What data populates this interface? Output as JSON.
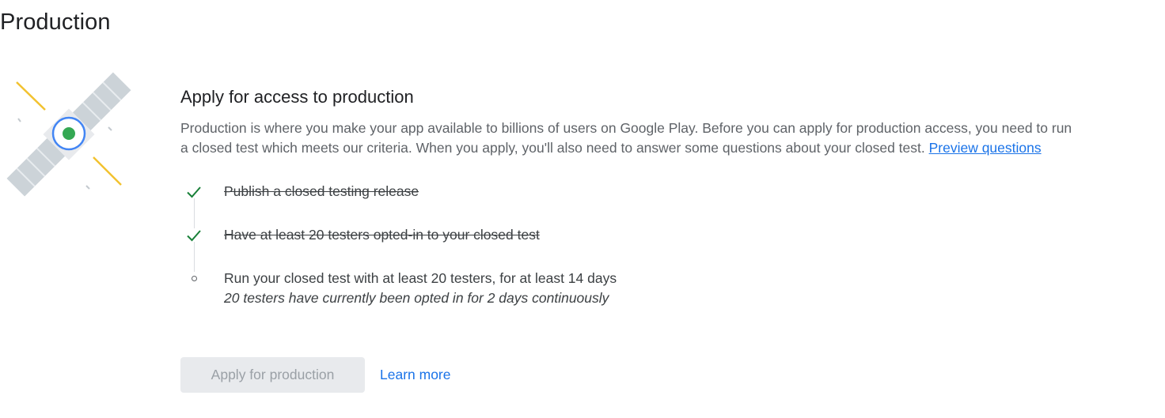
{
  "page": {
    "title": "Production"
  },
  "illustration": {
    "icon": "satellite-icon"
  },
  "section": {
    "title": "Apply for access to production",
    "description": "Production is where you make your app available to billions of users on Google Play. Before you can apply for production access, you need to run a closed test which meets our criteria. When you apply, you'll also need to answer some questions about your closed test. ",
    "preview_link": "Preview questions"
  },
  "checklist": {
    "items": [
      {
        "label": "Publish a closed testing release",
        "status": "complete",
        "icon": "check-icon"
      },
      {
        "label": "Have at least 20 testers opted-in to your closed test",
        "status": "complete",
        "icon": "check-icon"
      },
      {
        "label": "Run your closed test with at least 20 testers, for at least 14 days",
        "sublabel": "20 testers have currently been opted in for 2 days continuously",
        "status": "incomplete",
        "icon": "circle-icon"
      }
    ]
  },
  "actions": {
    "apply_label": "Apply for production",
    "learn_more_label": "Learn more"
  },
  "colors": {
    "check": "#188038",
    "link": "#1a73e8",
    "disabled_button_bg": "#e8eaed",
    "disabled_button_text": "#9aa0a6"
  }
}
